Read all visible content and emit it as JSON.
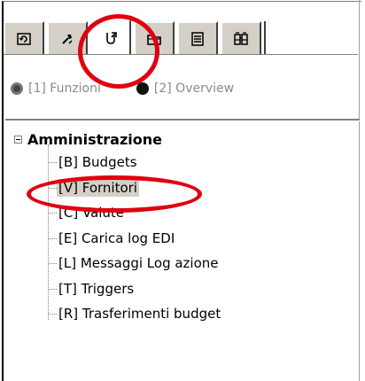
{
  "toolbar": {
    "tabs": [
      {
        "icon": "refresh-icon",
        "active": false
      },
      {
        "icon": "tools-icon",
        "active": false
      },
      {
        "icon": "cursor-arrow-icon",
        "active": true
      },
      {
        "icon": "folder-icon",
        "active": false
      },
      {
        "icon": "list-icon",
        "active": false
      },
      {
        "icon": "binoculars-icon",
        "active": false
      }
    ]
  },
  "view_options": [
    {
      "label": "[1] Funzioni",
      "checked": true
    },
    {
      "label": "[2] Overview",
      "checked": false
    }
  ],
  "tree": {
    "root_label": "Amministrazione",
    "items": [
      {
        "label": "[B] Budgets",
        "selected": false
      },
      {
        "label": "[V] Fornitori",
        "selected": true
      },
      {
        "label": "[C] Valute",
        "selected": false
      },
      {
        "label": "[E] Carica log EDI",
        "selected": false
      },
      {
        "label": "[L] Messaggi Log azione",
        "selected": false
      },
      {
        "label": "[T] Triggers",
        "selected": false
      },
      {
        "label": "[R] Trasferimenti budget",
        "selected": false
      }
    ]
  },
  "annotation_color": "#e0000f"
}
